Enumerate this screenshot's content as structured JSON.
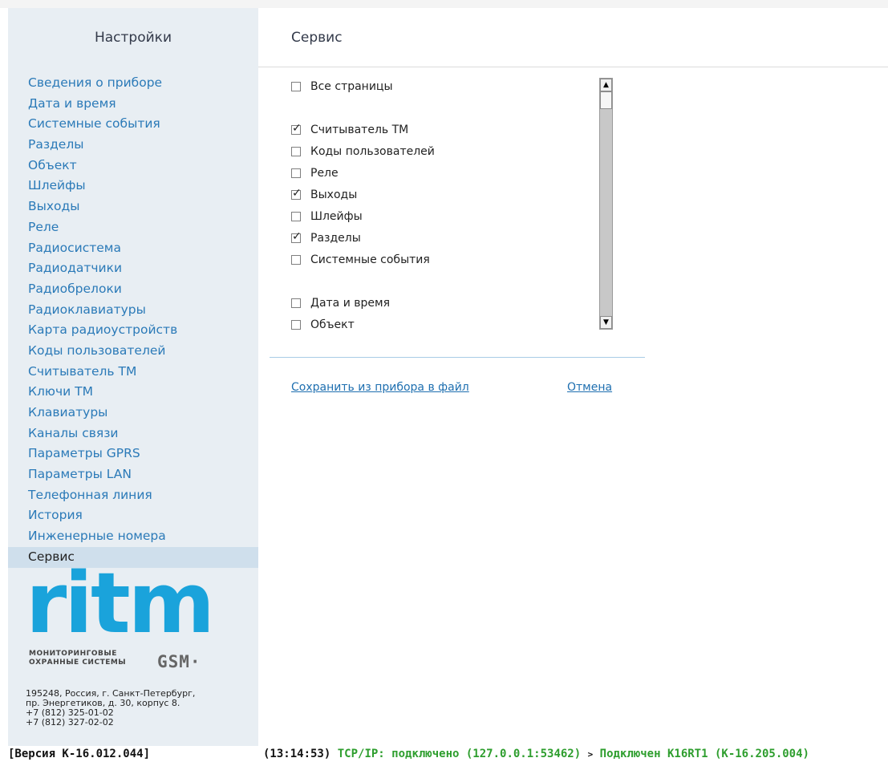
{
  "sidebar": {
    "title": "Настройки",
    "items": [
      {
        "label": "Сведения о приборе",
        "name": "sidebar-item-device-info"
      },
      {
        "label": "Дата и время",
        "name": "sidebar-item-date-time"
      },
      {
        "label": "Системные события",
        "name": "sidebar-item-system-events"
      },
      {
        "label": "Разделы",
        "name": "sidebar-item-partitions"
      },
      {
        "label": "Объект",
        "name": "sidebar-item-object"
      },
      {
        "label": "Шлейфы",
        "name": "sidebar-item-loops"
      },
      {
        "label": "Выходы",
        "name": "sidebar-item-outputs"
      },
      {
        "label": "Реле",
        "name": "sidebar-item-relay"
      },
      {
        "label": "Радиосистема",
        "name": "sidebar-item-radio-system"
      },
      {
        "label": "Радиодатчики",
        "name": "sidebar-item-radio-sensors"
      },
      {
        "label": "Радиобрелоки",
        "name": "sidebar-item-radio-keyfobs"
      },
      {
        "label": "Радиоклавиатуры",
        "name": "sidebar-item-radio-keypads"
      },
      {
        "label": "Карта радиоустройств",
        "name": "sidebar-item-radio-map"
      },
      {
        "label": "Коды пользователей",
        "name": "sidebar-item-user-codes"
      },
      {
        "label": "Считыватель ТМ",
        "name": "sidebar-item-tm-reader"
      },
      {
        "label": "Ключи ТМ",
        "name": "sidebar-item-tm-keys"
      },
      {
        "label": "Клавиатуры",
        "name": "sidebar-item-keypads"
      },
      {
        "label": "Каналы связи",
        "name": "sidebar-item-channels"
      },
      {
        "label": "Параметры GPRS",
        "name": "sidebar-item-gprs"
      },
      {
        "label": "Параметры LAN",
        "name": "sidebar-item-lan"
      },
      {
        "label": "Телефонная линия",
        "name": "sidebar-item-phone-line"
      },
      {
        "label": "История",
        "name": "sidebar-item-history"
      },
      {
        "label": "Инженерные номера",
        "name": "sidebar-item-engineer-numbers"
      },
      {
        "label": "Сервис",
        "name": "sidebar-item-service",
        "active": true
      }
    ]
  },
  "logo": {
    "word": "ritm",
    "sub_line1": "МОНИТОРИНГОВЫЕ",
    "sub_line2": "ОХРАННЫЕ СИСТЕМЫ",
    "gsm": "GSM·",
    "brand_color": "#1aa3db"
  },
  "address": {
    "line1": "195248, Россия, г. Санкт-Петербург,",
    "line2": "пр. Энергетиков, д. 30, корпус 8.",
    "line3": "+7 (812) 325-01-02",
    "line4": "+7 (812) 327-02-02"
  },
  "main": {
    "title": "Сервис",
    "checkboxes": [
      {
        "label": "Все страницы",
        "checked": false
      },
      {
        "label": "Считыватель ТМ",
        "checked": true
      },
      {
        "label": "Коды пользователей",
        "checked": false
      },
      {
        "label": "Реле",
        "checked": false
      },
      {
        "label": "Выходы",
        "checked": true
      },
      {
        "label": "Шлейфы",
        "checked": false
      },
      {
        "label": "Разделы",
        "checked": true
      },
      {
        "label": "Системные события",
        "checked": false
      },
      {
        "label": "Дата и время",
        "checked": false
      },
      {
        "label": "Объект",
        "checked": false
      }
    ],
    "save_link": "Сохранить из прибора в файл",
    "cancel_link": "Отмена"
  },
  "status": {
    "version": "[Версия К-16.012.044]",
    "time": "(13:14:53)",
    "tcp": "TCP/IP: подключено (127.0.0.1:53462)",
    "arrow": ">",
    "device": "Подключен K16RT1 (К-16.205.004)"
  },
  "colors": {
    "sidebar_bg": "#e8eef3",
    "active_item_bg": "#cfdfec",
    "link": "#2b7ab8",
    "status_green": "#2e9e2e"
  }
}
